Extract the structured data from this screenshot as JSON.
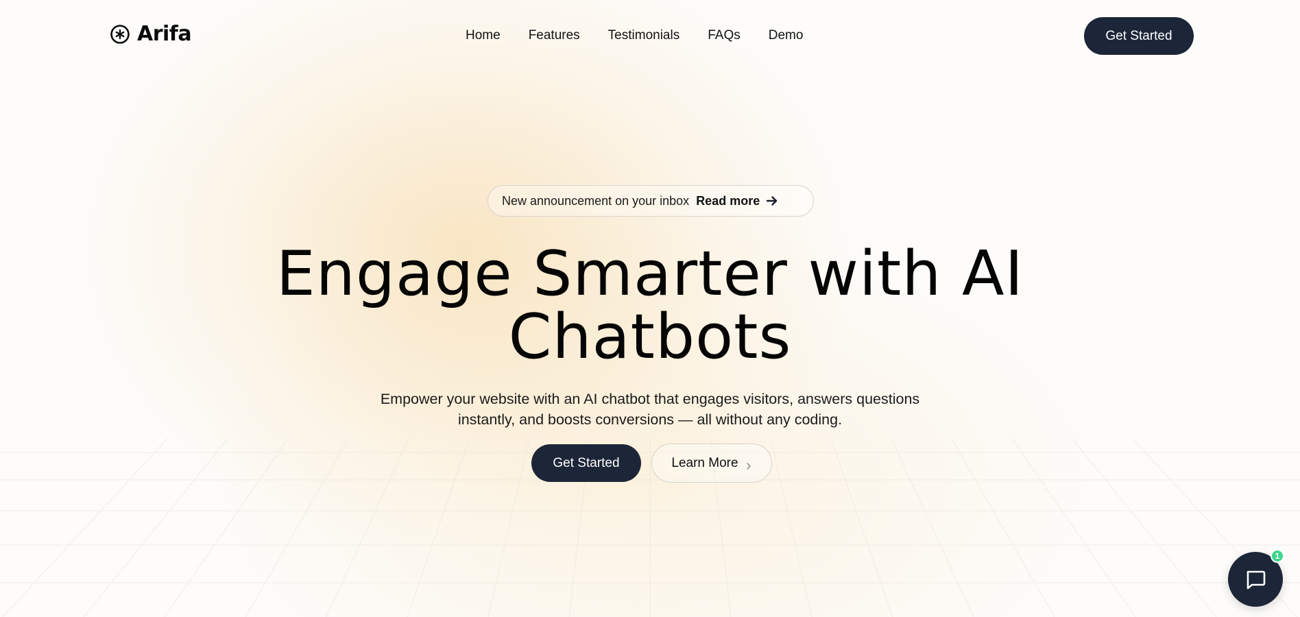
{
  "brand": {
    "name": "Arifa"
  },
  "nav": {
    "items": [
      {
        "label": "Home"
      },
      {
        "label": "Features"
      },
      {
        "label": "Testimonials"
      },
      {
        "label": "FAQs"
      },
      {
        "label": "Demo"
      }
    ],
    "cta_label": "Get Started"
  },
  "announcement": {
    "text": "New announcement on your inbox",
    "link_label": "Read more"
  },
  "hero": {
    "title_line1": "Engage Smarter with AI",
    "title_line2": "Chatbots",
    "subtitle_line1": "Empower your website with an AI chatbot that engages visitors, answers questions",
    "subtitle_line2": "instantly, and boosts conversions — all without any coding.",
    "primary_label": "Get Started",
    "secondary_label": "Learn More"
  },
  "chat_widget": {
    "badge_count": "1"
  },
  "colors": {
    "primary_dark": "#1c2638",
    "badge_green": "#3dd68c",
    "warm_glow": "#f5d296"
  },
  "icons": {
    "logo": "asterisk-circle-icon",
    "announcement_arrow": "arrow-right-icon",
    "learn_more": "chevron-right-icon",
    "chat": "chat-bubble-icon"
  }
}
